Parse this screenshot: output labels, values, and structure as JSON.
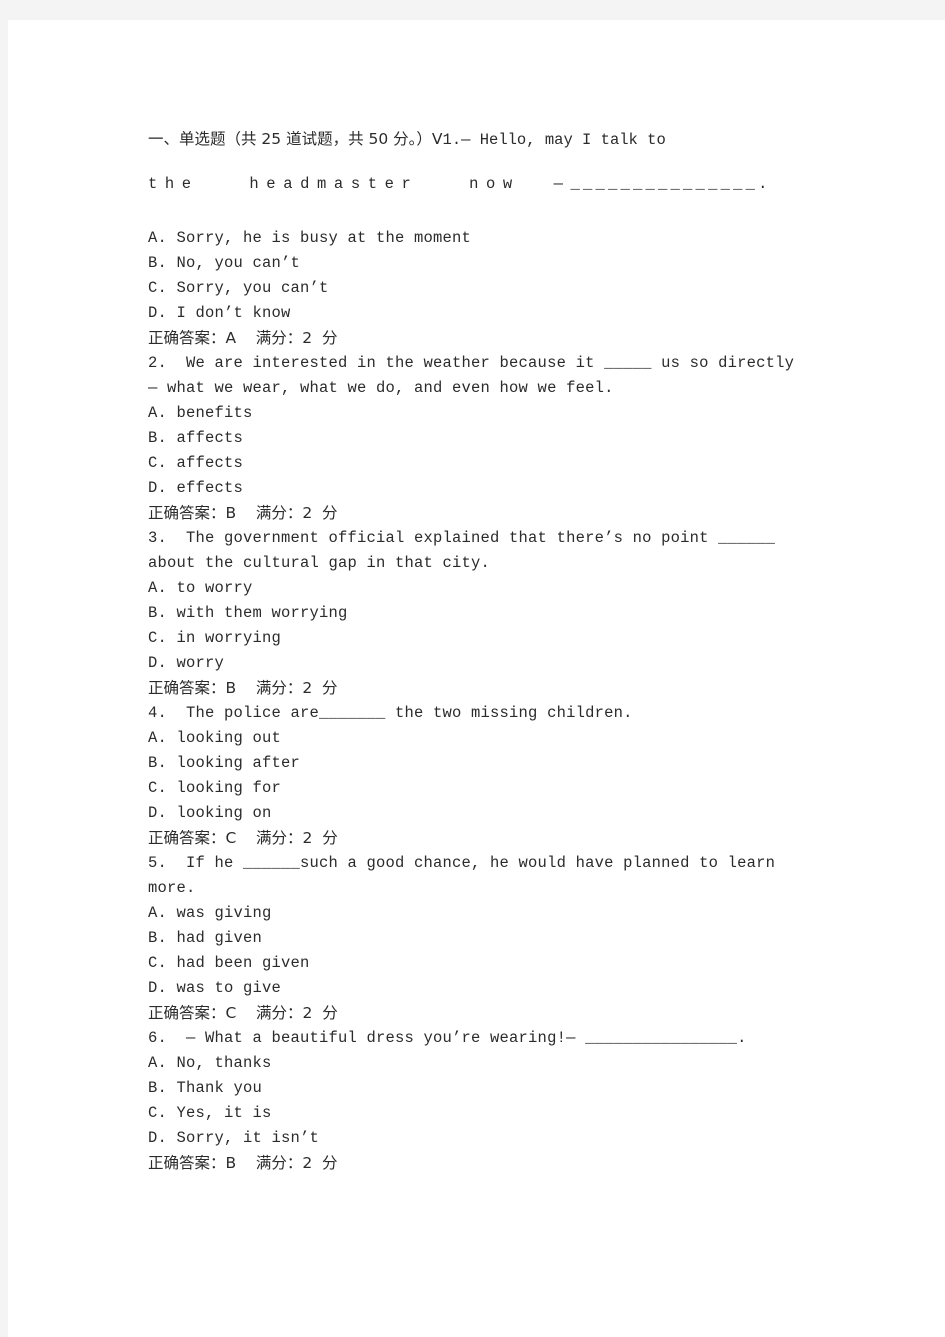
{
  "document": {
    "section_heading": "一、单选题（共 25 道试题，共 50 分。）V",
    "heading_inline_question_number": "1.",
    "heading_inline_question_text": "— Hello, may I talk to",
    "heading_wrap_line": "the   headmaster   now  —",
    "heading_wrap_blank": "_______________.",
    "answer_label": "正确答案：",
    "score_label": "满分：",
    "score_unit": "分",
    "score_value": "2"
  },
  "questions": [
    {
      "number": "1.",
      "stem_lines": [],
      "options": [
        "A. Sorry, he is busy at the moment",
        "B. No, you can’t",
        "C. Sorry, you can’t",
        "D. I don’t know"
      ],
      "answer": "A",
      "score": "2",
      "answer_line": "正确答案：A    满分：2  分"
    },
    {
      "number": "2.",
      "stem_lines": [
        "2.  We are interested in the weather because it _____ us so directly",
        "— what we wear, what we do, and even how we feel."
      ],
      "options": [
        "A. benefits",
        "B. affects",
        "C. affects",
        "D. effects"
      ],
      "answer": "B",
      "score": "2",
      "answer_line": "正确答案：B    满分：2  分"
    },
    {
      "number": "3.",
      "stem_lines": [
        "3.  The government official explained that there’s no point ______",
        "about the cultural gap in that city."
      ],
      "options": [
        "A. to worry",
        "B. with them worrying",
        "C. in worrying",
        "D. worry"
      ],
      "answer": "B",
      "score": "2",
      "answer_line": "正确答案：B    满分：2  分"
    },
    {
      "number": "4.",
      "stem_lines": [
        "4.  The police are_______ the two missing children."
      ],
      "options": [
        "A. looking out",
        "B. looking after",
        "C. looking for",
        "D. looking on"
      ],
      "answer": "C",
      "score": "2",
      "answer_line": "正确答案：C    满分：2  分"
    },
    {
      "number": "5.",
      "stem_lines": [
        "5.  If he ______such a good chance, he would have planned to learn",
        "more."
      ],
      "options": [
        "A. was giving",
        "B. had given",
        "C. had been given",
        "D. was to give"
      ],
      "answer": "C",
      "score": "2",
      "answer_line": "正确答案：C    满分：2  分"
    },
    {
      "number": "6.",
      "stem_lines": [
        "6.  — What a beautiful dress you’re wearing!— ________________."
      ],
      "options": [
        "A. No, thanks",
        "B. Thank you",
        "C. Yes, it is",
        "D. Sorry, it isn’t"
      ],
      "answer": "B",
      "score": "2",
      "answer_line": "正确答案：B    满分：2  分"
    }
  ],
  "colors": {
    "page_background": "#ffffff",
    "canvas_background": "#f4f4f4",
    "text": "#2b2b2b"
  }
}
